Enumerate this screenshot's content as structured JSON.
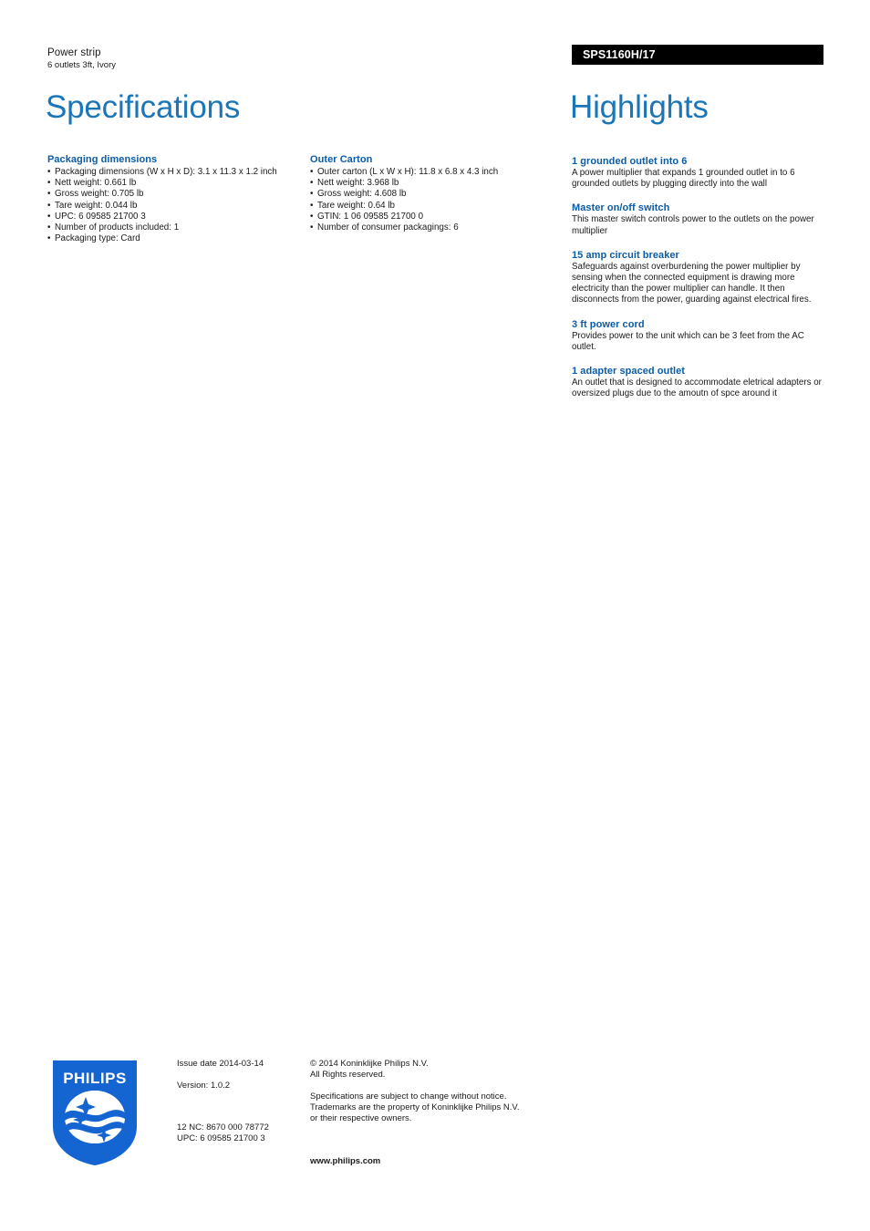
{
  "header": {
    "product_name": "Power strip",
    "product_subtitle": "6 outlets 3ft, Ivory",
    "model_code": "SPS1160H/17",
    "title_left": "Specifications",
    "title_right": "Highlights"
  },
  "specifications": [
    {
      "heading": "Packaging dimensions",
      "items": [
        "Packaging dimensions (W x H x D): 3.1 x 11.3 x 1.2 inch",
        "Nett weight: 0.661 lb",
        "Gross weight: 0.705 lb",
        "Tare weight: 0.044 lb",
        "UPC: 6 09585 21700 3",
        "Number of products included: 1",
        "Packaging type: Card"
      ]
    },
    {
      "heading": "Outer Carton",
      "items": [
        "Outer carton (L x W x H): 11.8 x 6.8 x 4.3 inch",
        "Nett weight: 3.968 lb",
        "Gross weight: 4.608 lb",
        "Tare weight: 0.64 lb",
        "GTIN: 1 06 09585 21700 0",
        "Number of consumer packagings: 6"
      ]
    }
  ],
  "highlights": [
    {
      "title": "1 grounded outlet into 6",
      "body": "A power multiplier that expands 1 grounded outlet in to 6 grounded outlets by plugging directly into the wall"
    },
    {
      "title": "Master on/off switch",
      "body": "This master switch controls power to the outlets on the power multiplier"
    },
    {
      "title": "15 amp circuit breaker",
      "body": "Safeguards against overburdening the power multiplier by sensing when the connected equipment is drawing more electricity than the power multiplier can handle. It then disconnects from the power, guarding against electrical fires."
    },
    {
      "title": "3 ft power cord",
      "body": "Provides power to the unit which can be 3 feet from the AC outlet."
    },
    {
      "title": "1 adapter spaced outlet",
      "body": "An outlet that is designed to accommodate eletrical adapters or oversized plugs due to the amoutn of spce around it"
    }
  ],
  "footer": {
    "logo_wordmark": "PHILIPS",
    "issue_date": "Issue date 2014-03-14",
    "version": "Version: 1.0.2",
    "nc_code": "12 NC: 8670 000 78772",
    "upc": "UPC: 6 09585 21700 3",
    "copyright_line1": "© 2014 Koninklijke Philips N.V.",
    "copyright_line2": "All Rights reserved.",
    "disclaimer_line1": "Specifications are subject to change without notice.",
    "disclaimer_line2": "Trademarks are the property of Koninklijke Philips N.V.",
    "disclaimer_line3": "or their respective owners.",
    "website": "www.philips.com"
  },
  "colors": {
    "title_blue": "#1b76b8",
    "heading_blue": "#0b5ca8",
    "philips_blue": "#1464d2",
    "bar_black": "#000000",
    "body_text": "#1a1a1a"
  }
}
